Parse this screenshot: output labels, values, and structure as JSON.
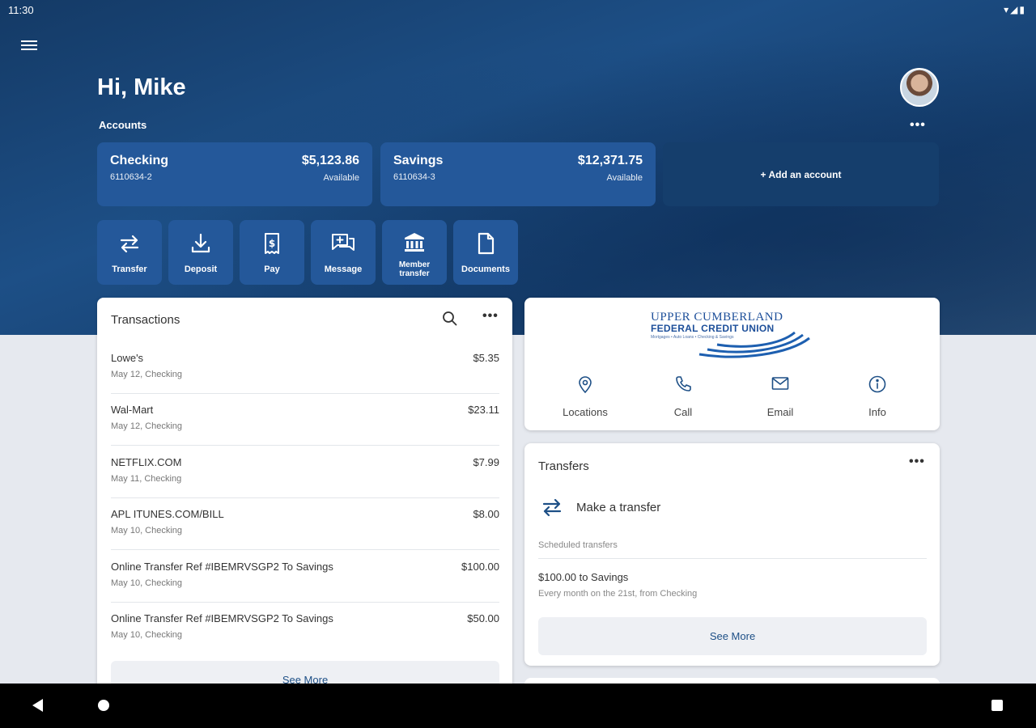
{
  "status_bar": {
    "time": "11:30"
  },
  "header": {
    "greeting": "Hi, Mike"
  },
  "accounts": {
    "label": "Accounts",
    "items": [
      {
        "name": "Checking",
        "number": "6110634-2",
        "balance": "$5,123.86",
        "balance_label": "Available"
      },
      {
        "name": "Savings",
        "number": "6110634-3",
        "balance": "$12,371.75",
        "balance_label": "Available"
      }
    ],
    "add_label": "+ Add an account"
  },
  "actions": [
    {
      "label": "Transfer",
      "icon": "transfer-icon"
    },
    {
      "label": "Deposit",
      "icon": "deposit-icon"
    },
    {
      "label": "Pay",
      "icon": "pay-icon"
    },
    {
      "label": "Message",
      "icon": "message-icon"
    },
    {
      "label": "Member transfer",
      "icon": "bank-icon"
    },
    {
      "label": "Documents",
      "icon": "document-icon"
    }
  ],
  "transactions": {
    "title": "Transactions",
    "items": [
      {
        "desc": "Lowe's",
        "sub": "May 12, Checking",
        "amount": "$5.35"
      },
      {
        "desc": "Wal-Mart",
        "sub": "May 12, Checking",
        "amount": "$23.11"
      },
      {
        "desc": "NETFLIX.COM",
        "sub": "May 11, Checking",
        "amount": "$7.99"
      },
      {
        "desc": "APL ITUNES.COM/BILL",
        "sub": "May 10, Checking",
        "amount": "$8.00"
      },
      {
        "desc": "Online Transfer Ref #IBEMRVSGP2 To Savings",
        "sub": "May 10, Checking",
        "amount": "$100.00"
      },
      {
        "desc": "Online Transfer Ref #IBEMRVSGP2 To Savings",
        "sub": "May 10, Checking",
        "amount": "$50.00"
      }
    ],
    "see_more": "See More"
  },
  "credit_union": {
    "logo_line1": "UPPER CUMBERLAND",
    "logo_line2": "FEDERAL CREDIT UNION",
    "logo_tagline": "Mortgages • Auto Loans • Checking & Savings",
    "links": [
      {
        "label": "Locations",
        "icon": "location-pin-icon"
      },
      {
        "label": "Call",
        "icon": "phone-icon"
      },
      {
        "label": "Email",
        "icon": "email-icon"
      },
      {
        "label": "Info",
        "icon": "info-icon"
      }
    ]
  },
  "transfers": {
    "title": "Transfers",
    "make_label": "Make a transfer",
    "scheduled_label": "Scheduled transfers",
    "scheduled": {
      "title": "$100.00 to Savings",
      "detail": "Every month on the 21st, from Checking"
    },
    "see_more": "See More"
  },
  "colors": {
    "brand_dark": "#143a66",
    "tile": "#24589a",
    "add_tile": "#153e6c",
    "link": "#1d4f86"
  }
}
